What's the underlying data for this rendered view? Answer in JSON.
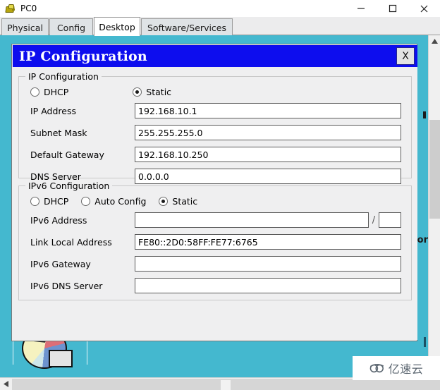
{
  "window": {
    "title": "PC0",
    "icon": "device-icon",
    "controls": {
      "minimize": "–",
      "maximize": "□",
      "close": "✕"
    }
  },
  "tabs": [
    {
      "label": "Physical",
      "active": false
    },
    {
      "label": "Config",
      "active": false
    },
    {
      "label": "Desktop",
      "active": true
    },
    {
      "label": "Software/Services",
      "active": false
    }
  ],
  "dialog": {
    "title": "IP Configuration",
    "close_label": "X",
    "ipv4": {
      "legend": "IP Configuration",
      "modes": [
        {
          "label": "DHCP",
          "selected": false
        },
        {
          "label": "Static",
          "selected": true
        }
      ],
      "fields": [
        {
          "label": "IP Address",
          "value": "192.168.10.1"
        },
        {
          "label": "Subnet Mask",
          "value": "255.255.255.0"
        },
        {
          "label": "Default Gateway",
          "value": "192.168.10.250"
        },
        {
          "label": "DNS Server",
          "value": "0.0.0.0"
        }
      ]
    },
    "ipv6": {
      "legend": "IPv6 Configuration",
      "modes": [
        {
          "label": "DHCP",
          "selected": false
        },
        {
          "label": "Auto Config",
          "selected": false
        },
        {
          "label": "Static",
          "selected": true
        }
      ],
      "address": {
        "label": "IPv6 Address",
        "value": "",
        "separator": "/",
        "prefix": ""
      },
      "fields": [
        {
          "label": "Link Local Address",
          "value": "FE80::2D0:58FF:FE77:6765"
        },
        {
          "label": "IPv6 Gateway",
          "value": ""
        },
        {
          "label": "IPv6 DNS Server",
          "value": ""
        }
      ]
    }
  },
  "desktop": {
    "background_color": "#44b8cf",
    "taskbar_icon": "pie-chart-monitor-icon",
    "hidden_text": "or"
  },
  "scrollbars": {
    "vertical_up": "▲",
    "vertical_down": "▼",
    "horizontal_left": "‹"
  },
  "watermark": {
    "text": "亿速云",
    "logo": "cloud-icon"
  },
  "colors": {
    "dialog_title_bar": "#0d0dee",
    "desktop_teal": "#44b8cf",
    "dialog_face": "#efeff0",
    "active_tab": "#ffffff"
  }
}
